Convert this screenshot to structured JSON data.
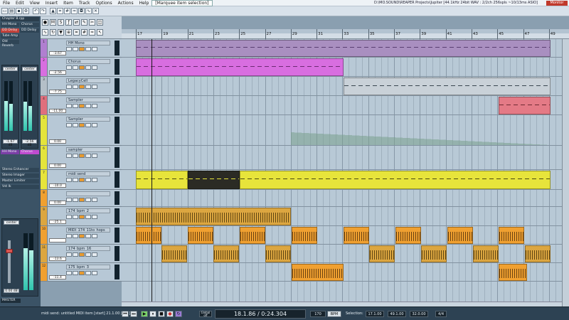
{
  "menu": {
    "items": [
      "File",
      "Edit",
      "View",
      "Insert",
      "Item",
      "Track",
      "Options",
      "Actions",
      "Help"
    ],
    "selected_action": "[Marquee item selection]"
  },
  "window_title": "D:\\MO.SOUND\\REAPER Projects\\Jupiter [44.1kHz 24bit WAV : 2/2ch 256spls ~10/13ms ASIO]",
  "monitor_badge": "Monitor",
  "left_panel": {
    "header": "Chapter 8.rpp",
    "fx_rows": [
      "HH Mono",
      "Chorus",
      "DD Delay",
      "DD Delay",
      "Tube Amp",
      "Old Reverb"
    ],
    "strip_values": [
      "-1.67 dB",
      "-2.56 dB"
    ],
    "folder_labels": [
      "HH Mono",
      "Chorus"
    ],
    "master_fx": [
      "Stereo Enhancer",
      "Stereo Imager",
      "Master Limiter",
      "Vst Ik"
    ],
    "master_label": "MASTER",
    "master_value": "0.00 dB",
    "center": "center"
  },
  "tracks": [
    {
      "num": "1",
      "name": "HH Mono",
      "vol": "-3.67",
      "color": "#b07fd0"
    },
    {
      "num": "2",
      "name": "Chorus",
      "vol": "-2.56",
      "color": "#d86ee0"
    },
    {
      "num": "3",
      "name": "LegacyCell",
      "vol": "-7.75",
      "color": "#b4bfc8"
    },
    {
      "num": "4",
      "name": "Sampler",
      "vol": "-11.00",
      "color": "#e06f7d"
    },
    {
      "num": "5",
      "name": "Sampler",
      "vol": "0.00",
      "color": "#e4e43c"
    },
    {
      "num": "6",
      "name": "sampler",
      "vol": "0.00",
      "color": "#e4e43c"
    },
    {
      "num": "7",
      "name": "midi send",
      "vol": "-10.0",
      "color": "#e7e43b"
    },
    {
      "num": "8",
      "name": "",
      "vol": "0.00",
      "color": "#f0a030"
    },
    {
      "num": "9",
      "name": "174_bpm_2",
      "vol": "-25.1",
      "color": "#dca640"
    },
    {
      "num": "10",
      "name": "MIDI_174_11to_hops",
      "vol": "",
      "color": "#f0a030"
    },
    {
      "num": "11",
      "name": "174_bpm_16",
      "vol": "-13.6",
      "color": "#dca640"
    },
    {
      "num": "12",
      "name": "175_bpm_3",
      "vol": "-11.4",
      "color": "#f0a030"
    }
  ],
  "ruler_labels": [
    "17",
    "19",
    "21",
    "23",
    "25",
    "27",
    "29",
    "31",
    "33",
    "35",
    "37",
    "39",
    "41",
    "43",
    "45",
    "47",
    "49"
  ],
  "status_text": "midi send: untitled MIDI item [start] 21.1.00 [end]",
  "transport": {
    "position": "18.1.86 / 0:24.304",
    "bpm": "170",
    "bpm_label": "BPM",
    "selection_label": "Selection:",
    "sel_start": "17.1.00",
    "sel_end": "49.1.00",
    "sel_len": "32.0.00",
    "timesig": "4/4",
    "global_label": "Global off"
  },
  "colors": {
    "bg": "#8a9fb0",
    "panel": "#3b5366",
    "accent": "#c0392b"
  }
}
